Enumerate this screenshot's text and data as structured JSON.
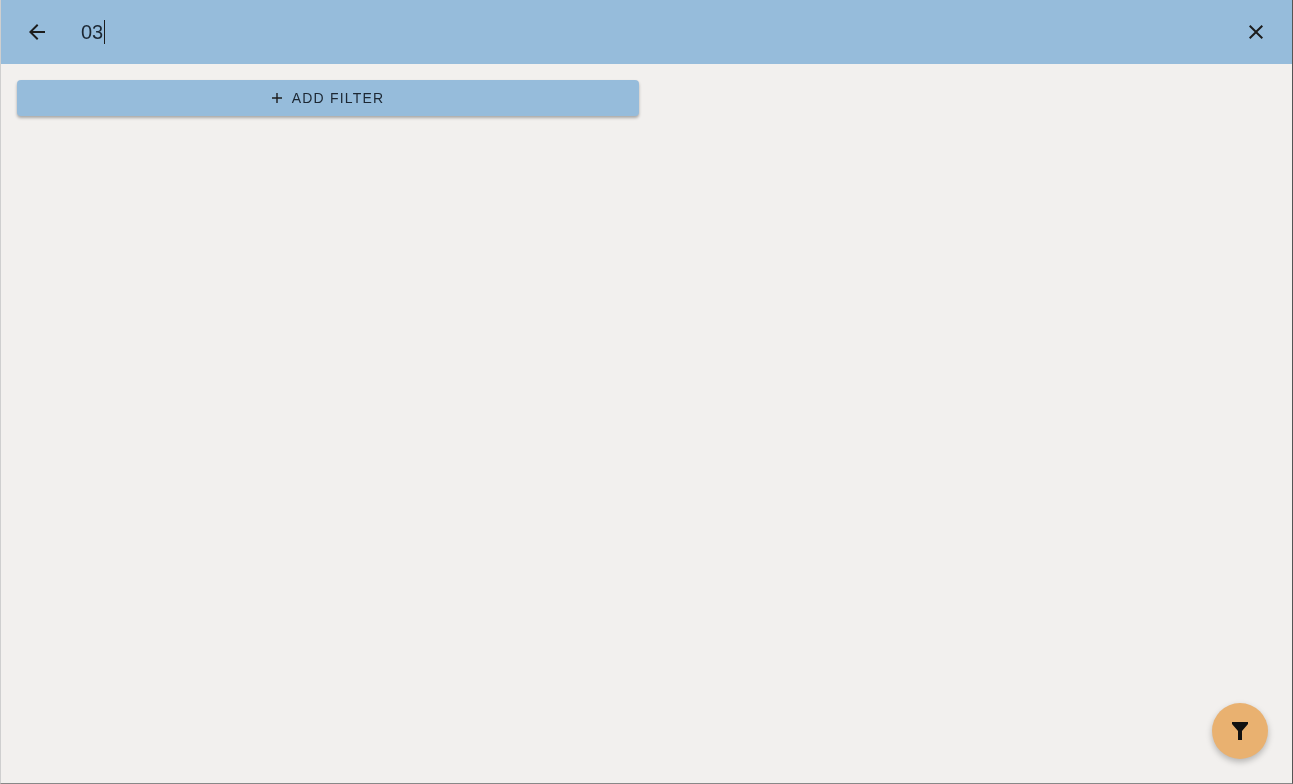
{
  "toolbar": {
    "search": {
      "value": "03"
    }
  },
  "add_filter_button": {
    "label": "ADD FILTER"
  }
}
